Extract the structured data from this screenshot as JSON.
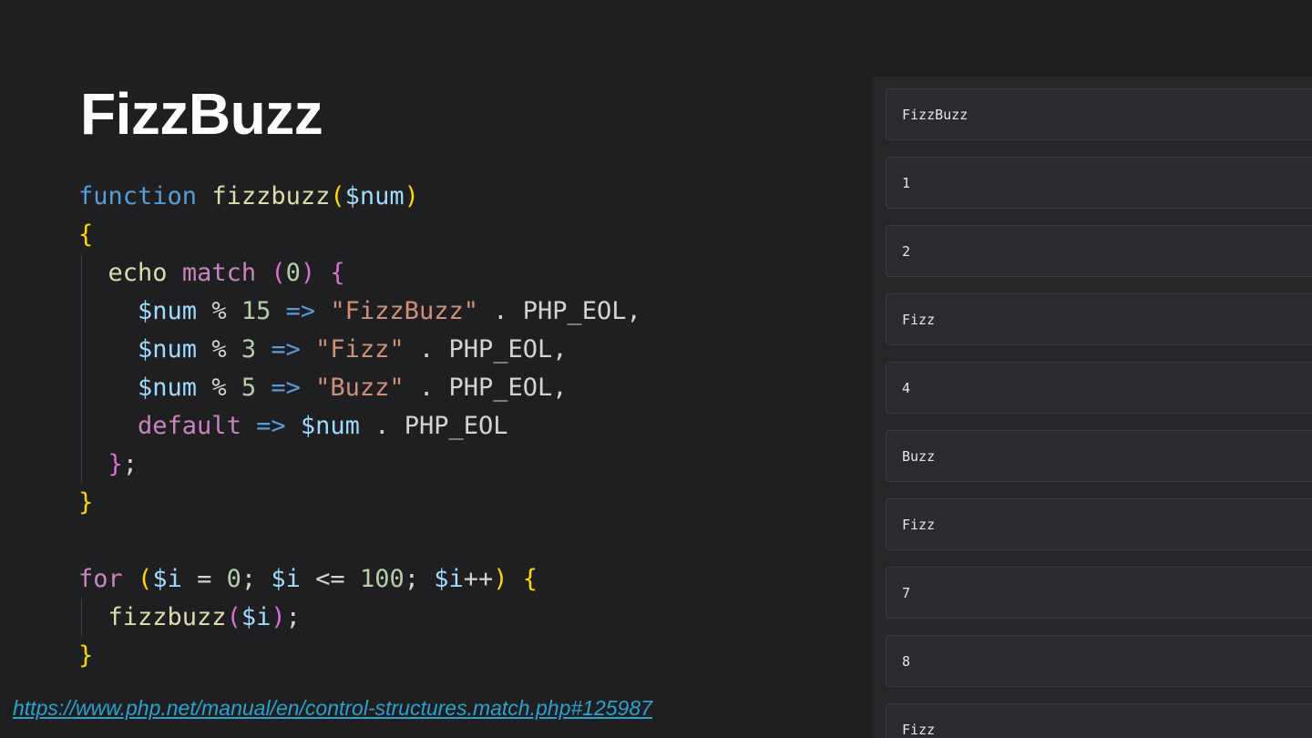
{
  "slide": {
    "title": "FizzBuzz",
    "link": "https://www.php.net/manual/en/control-structures.match.php#125987"
  },
  "code": {
    "language": "php",
    "lines": [
      "function fizzbuzz($num)",
      "{",
      "  echo match (0) {",
      "    $num % 15 => \"FizzBuzz\" . PHP_EOL,",
      "    $num % 3 => \"Fizz\" . PHP_EOL,",
      "    $num % 5 => \"Buzz\" . PHP_EOL,",
      "    default => $num . PHP_EOL",
      "  };",
      "}",
      "",
      "for ($i = 0; $i <= 100; $i++) {",
      "  fizzbuzz($i);",
      "}"
    ],
    "tokens": {
      "kw_function": "function",
      "fn_name": "fizzbuzz",
      "param": "$num",
      "echo": "echo",
      "match": "match",
      "zero": "0",
      "n15": "15",
      "n3": "3",
      "n5": "5",
      "arrow": "=>",
      "s_fizzbuzz": "\"FizzBuzz\"",
      "s_fizz": "\"Fizz\"",
      "s_buzz": "\"Buzz\"",
      "eol": "PHP_EOL",
      "default": "default",
      "for": "for",
      "var_i": "$i",
      "n100": "100"
    }
  },
  "output": {
    "rows": [
      "FizzBuzz",
      "1",
      "2",
      "Fizz",
      "4",
      "Buzz",
      "Fizz",
      "7",
      "8",
      "Fizz"
    ]
  },
  "colors": {
    "background": "#1f1f21",
    "panel": "#262629",
    "keyword": "#569cd6",
    "function": "#dcdcaa",
    "control": "#c586c0",
    "variable": "#9cdcfe",
    "number": "#b5cea8",
    "string": "#ce9178",
    "bracket1": "#ffd700",
    "bracket2": "#da70d6",
    "link": "#29a3cc"
  }
}
